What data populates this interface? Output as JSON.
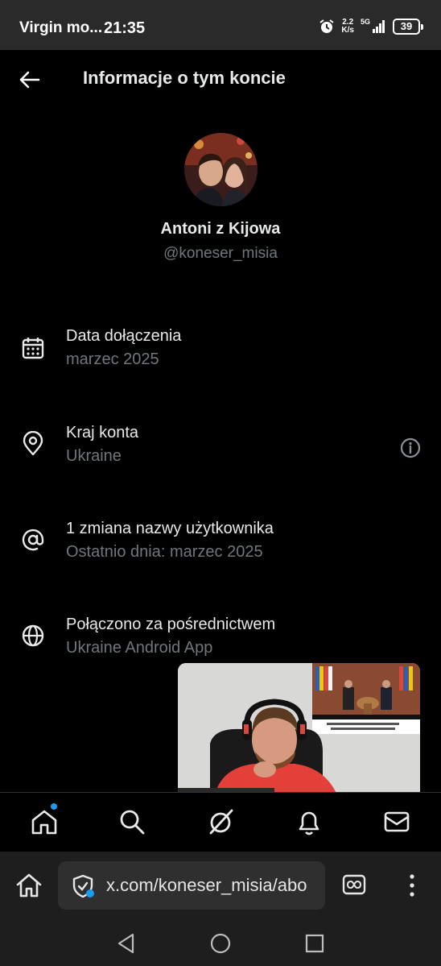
{
  "status_bar": {
    "carrier": "Virgin mo...",
    "time": "21:35",
    "speed_value": "2.2",
    "speed_unit": "K/s",
    "network": "5G",
    "battery": "39"
  },
  "header": {
    "title": "Informacje o tym koncie"
  },
  "profile": {
    "display_name": "Antoni z Kijowa",
    "handle": "@koneser_misia"
  },
  "info_items": [
    {
      "label": "Data dołączenia",
      "value": "marzec 2025",
      "icon": "calendar-icon"
    },
    {
      "label": "Kraj konta",
      "value": "Ukraine",
      "icon": "location-pin-icon",
      "extra_icon": "info-icon"
    },
    {
      "label": "1 zmiana nazwy użytkownika",
      "value": "Ostatnio dnia: marzec 2025",
      "icon": "at-sign-icon"
    },
    {
      "label": "Połączono za pośrednictwem",
      "value": "Ukraine Android App",
      "icon": "globe-icon"
    }
  ],
  "bottom_nav": {
    "items": [
      "home-icon",
      "search-icon",
      "grok-icon",
      "bell-icon",
      "mail-icon"
    ],
    "accent": "#1d9bf0"
  },
  "browser": {
    "url": "x.com/koneser_misia/abo"
  },
  "colors": {
    "background": "#000000",
    "text_primary": "#e7e9ea",
    "text_secondary": "#71767b",
    "accent": "#1d9bf0"
  }
}
